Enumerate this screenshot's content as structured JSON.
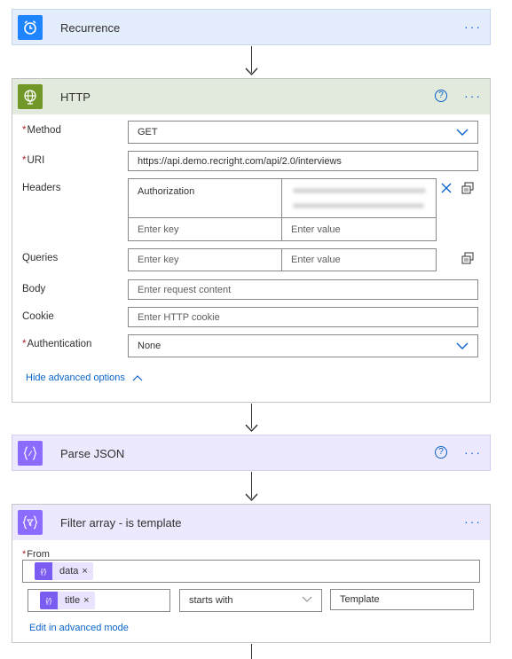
{
  "colors": {
    "recurrence_header_bg": "#e3edfc",
    "recurrence_icon_bg": "#1f85ff",
    "http_header_bg": "#e2e9dd",
    "http_icon_bg": "#709727",
    "json_header_bg": "#ece8fe",
    "json_icon_bg": "#8c6cff",
    "link": "#0a63c9",
    "required": "#a4262c"
  },
  "recurrence": {
    "title": "Recurrence",
    "icon": "alarm-clock-icon"
  },
  "http": {
    "title": "HTTP",
    "icon": "globe-icon",
    "method": {
      "label": "Method",
      "value": "GET"
    },
    "uri": {
      "label": "URI",
      "value": "https://api.demo.recright.com/api/2.0/interviews"
    },
    "headers": {
      "label": "Headers",
      "key1": "Authorization",
      "key_placeholder": "Enter key",
      "value_placeholder": "Enter value"
    },
    "queries": {
      "label": "Queries",
      "key_placeholder": "Enter key",
      "value_placeholder": "Enter value"
    },
    "body": {
      "label": "Body",
      "placeholder": "Enter request content"
    },
    "cookie": {
      "label": "Cookie",
      "placeholder": "Enter HTTP cookie"
    },
    "authentication": {
      "label": "Authentication",
      "value": "None"
    },
    "hide_advanced": "Hide advanced options"
  },
  "parse_json": {
    "title": "Parse JSON",
    "icon": "curly-braces-icon"
  },
  "filter": {
    "title": "Filter array - is template",
    "icon": "filter-braces-icon",
    "from_label": "From",
    "from_token": "data",
    "condition_token": "title",
    "operator": "starts with",
    "value": "Template",
    "advanced_link": "Edit in advanced mode"
  },
  "required_mark": "*",
  "more_symbol": "···",
  "help_symbol": "?",
  "remove_symbol": "×"
}
